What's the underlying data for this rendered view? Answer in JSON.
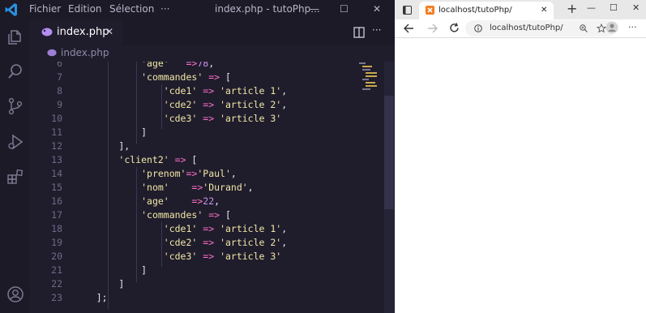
{
  "vscode": {
    "menu": [
      "Fichier",
      "Edition",
      "Sélection"
    ],
    "more": "···",
    "window_title": "index.php - tutoPhp...",
    "window_controls": {
      "minimize": "—",
      "maximize": "☐",
      "close": "✕"
    },
    "tab": {
      "label": "index.php",
      "close": "✕"
    },
    "breadcrumb": "index.php",
    "code_lines": [
      {
        "num": "6",
        "text": [
          [
            "p",
            "            "
          ],
          [
            "s",
            "'age'"
          ],
          [
            "p",
            "   "
          ],
          [
            "o",
            "=>"
          ],
          [
            "n",
            "78"
          ],
          [
            "p",
            ","
          ]
        ]
      },
      {
        "num": "7",
        "text": [
          [
            "p",
            "            "
          ],
          [
            "s",
            "'commandes'"
          ],
          [
            "p",
            " "
          ],
          [
            "o",
            "=>"
          ],
          [
            "p",
            " ["
          ]
        ]
      },
      {
        "num": "8",
        "text": [
          [
            "p",
            "                "
          ],
          [
            "s",
            "'cde1'"
          ],
          [
            "p",
            " "
          ],
          [
            "o",
            "=>"
          ],
          [
            "p",
            " "
          ],
          [
            "s",
            "'article 1'"
          ],
          [
            "p",
            ","
          ]
        ]
      },
      {
        "num": "9",
        "text": [
          [
            "p",
            "                "
          ],
          [
            "s",
            "'cde2'"
          ],
          [
            "p",
            " "
          ],
          [
            "o",
            "=>"
          ],
          [
            "p",
            " "
          ],
          [
            "s",
            "'article 2'"
          ],
          [
            "p",
            ","
          ]
        ]
      },
      {
        "num": "10",
        "text": [
          [
            "p",
            "                "
          ],
          [
            "s",
            "'cde3'"
          ],
          [
            "p",
            " "
          ],
          [
            "o",
            "=>"
          ],
          [
            "p",
            " "
          ],
          [
            "s",
            "'article 3'"
          ]
        ]
      },
      {
        "num": "11",
        "text": [
          [
            "p",
            "            ]"
          ]
        ]
      },
      {
        "num": "12",
        "text": [
          [
            "p",
            "        ],"
          ]
        ]
      },
      {
        "num": "13",
        "text": [
          [
            "p",
            "        "
          ],
          [
            "s",
            "'client2'"
          ],
          [
            "p",
            " "
          ],
          [
            "o",
            "=>"
          ],
          [
            "p",
            " ["
          ]
        ]
      },
      {
        "num": "14",
        "text": [
          [
            "p",
            "            "
          ],
          [
            "s",
            "'prenom'"
          ],
          [
            "o",
            "=>"
          ],
          [
            "s",
            "'Paul'"
          ],
          [
            "p",
            ","
          ]
        ]
      },
      {
        "num": "15",
        "text": [
          [
            "p",
            "            "
          ],
          [
            "s",
            "'nom'"
          ],
          [
            "p",
            "    "
          ],
          [
            "o",
            "=>"
          ],
          [
            "s",
            "'Durand'"
          ],
          [
            "p",
            ","
          ]
        ]
      },
      {
        "num": "16",
        "text": [
          [
            "p",
            "            "
          ],
          [
            "s",
            "'age'"
          ],
          [
            "p",
            "    "
          ],
          [
            "o",
            "=>"
          ],
          [
            "n",
            "22"
          ],
          [
            "p",
            ","
          ]
        ]
      },
      {
        "num": "17",
        "text": [
          [
            "p",
            "            "
          ],
          [
            "s",
            "'commandes'"
          ],
          [
            "p",
            " "
          ],
          [
            "o",
            "=>"
          ],
          [
            "p",
            " ["
          ]
        ]
      },
      {
        "num": "18",
        "text": [
          [
            "p",
            "                "
          ],
          [
            "s",
            "'cde1'"
          ],
          [
            "p",
            " "
          ],
          [
            "o",
            "=>"
          ],
          [
            "p",
            " "
          ],
          [
            "s",
            "'article 1'"
          ],
          [
            "p",
            ","
          ]
        ]
      },
      {
        "num": "19",
        "text": [
          [
            "p",
            "                "
          ],
          [
            "s",
            "'cde2'"
          ],
          [
            "p",
            " "
          ],
          [
            "o",
            "=>"
          ],
          [
            "p",
            " "
          ],
          [
            "s",
            "'article 2'"
          ],
          [
            "p",
            ","
          ]
        ]
      },
      {
        "num": "20",
        "text": [
          [
            "p",
            "                "
          ],
          [
            "s",
            "'cde3'"
          ],
          [
            "p",
            " "
          ],
          [
            "o",
            "=>"
          ],
          [
            "p",
            " "
          ],
          [
            "s",
            "'article 3'"
          ]
        ]
      },
      {
        "num": "21",
        "text": [
          [
            "p",
            "            ]"
          ]
        ]
      },
      {
        "num": "22",
        "text": [
          [
            "p",
            "        ]"
          ]
        ]
      },
      {
        "num": "23",
        "text": [
          [
            "p",
            "    ];"
          ]
        ]
      }
    ],
    "colors": {
      "string": "#f2e6a6",
      "operator": "#ff6ec7",
      "number": "#c792ea",
      "plain": "#e6e6ef",
      "bg": "#1f1d2c",
      "accent": "#1e90ff"
    }
  },
  "browser": {
    "tab_title": "localhost/tutoPhp/",
    "tab_close": "✕",
    "new_tab": "+",
    "window_controls": {
      "minimize": "—",
      "maximize": "☐",
      "close": "✕"
    },
    "url": "localhost/tutoPhp/",
    "more": "···"
  }
}
